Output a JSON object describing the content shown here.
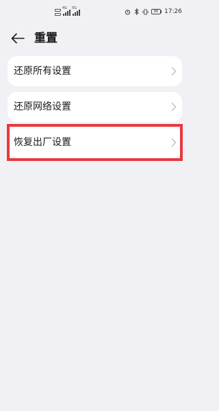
{
  "status_bar": {
    "network_type": "4G",
    "network_type_2": "5G",
    "battery": "86",
    "time": "17:26"
  },
  "header": {
    "title": "重置"
  },
  "options": [
    {
      "label": "还原所有设置"
    },
    {
      "label": "还原网络设置"
    },
    {
      "label": "恢复出厂设置"
    }
  ],
  "colors": {
    "background": "#f1f1f5",
    "card": "#ffffff",
    "highlight": "#e8383d"
  }
}
